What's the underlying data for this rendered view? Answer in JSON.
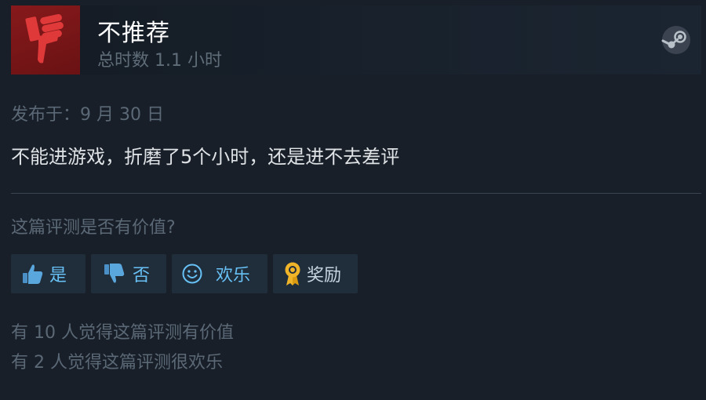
{
  "review": {
    "recommendation": "不推荐",
    "hours": "总时数 1.1 小时",
    "posted": "发布于：9 月 30 日",
    "text": "不能进游戏，折磨了5个小时，还是进不去差评"
  },
  "helpful": {
    "question": "这篇评测是否有价值?",
    "yes_label": "是",
    "no_label": "否",
    "funny_label": "欢乐",
    "award_label": "奖励"
  },
  "stats": {
    "helpful_line": "有 10 人觉得这篇评测有价值",
    "funny_line": "有 2 人觉得这篇评测很欢乐"
  },
  "icons": {
    "thumb": "thumbs-down-icon",
    "steam": "steam-logo-icon",
    "yes": "thumbs-up-icon",
    "no": "thumbs-down-icon",
    "funny": "smiley-icon",
    "award": "award-ribbon-icon"
  },
  "colors": {
    "background": "#181f29",
    "thumb_box": "#7a1818",
    "thumb_icon": "#e0393a",
    "button_bg": "#202d3b",
    "button_text": "#67c1f5",
    "award_icon": "#f0b429",
    "muted_text": "#5b6876"
  }
}
